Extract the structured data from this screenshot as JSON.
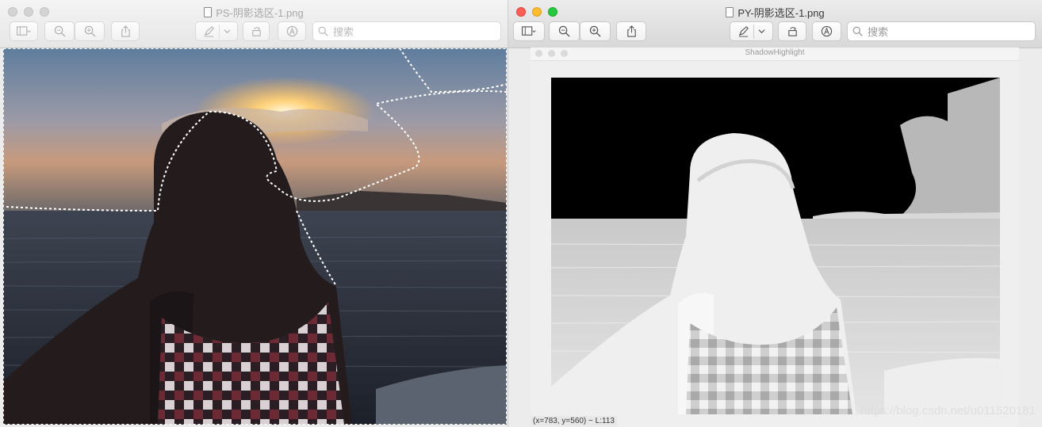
{
  "left_window": {
    "title": "PS-阴影选区-1.png",
    "search_placeholder": "搜索",
    "toolbar_icons": [
      "sidebar-toggle-icon",
      "zoom-out-icon",
      "zoom-in-icon",
      "share-icon",
      "markup-pen-icon",
      "chevron-down-icon",
      "rotate-icon",
      "annotate-icon",
      "search-icon"
    ],
    "image_description_icon": "photo-with-selection"
  },
  "right_window": {
    "title": "PY-阴影选区-1.png",
    "search_placeholder": "搜索",
    "viewer": {
      "title": "ShadowHighlight",
      "status": "(x=783, y=560) ~ L:113"
    }
  },
  "watermark": "https://blog.csdn.net/u011520181",
  "colors": {
    "close": "#fd5f57",
    "minimize": "#febc2e",
    "zoom": "#28c840",
    "inactive_light": "#d4d4d4"
  }
}
